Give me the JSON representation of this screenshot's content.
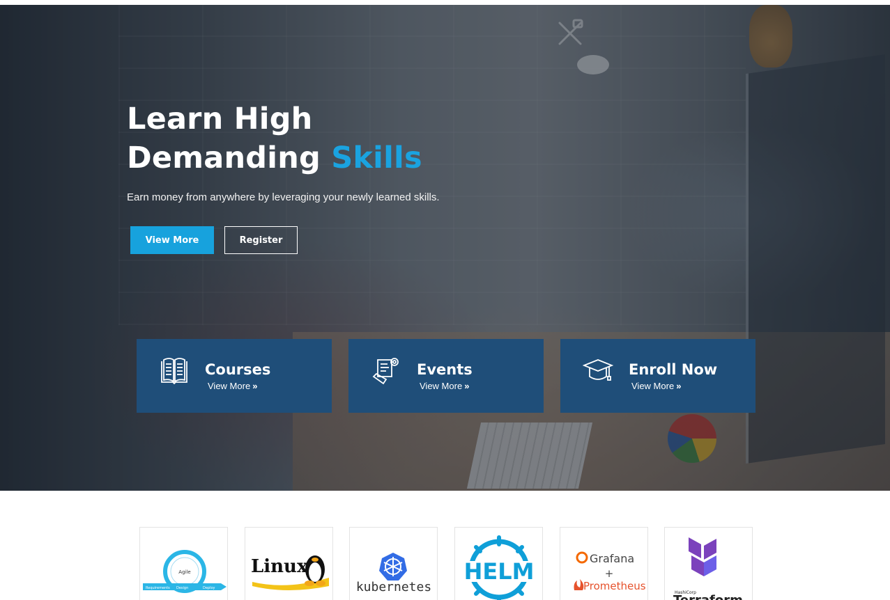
{
  "hero": {
    "title_line1": "Learn High",
    "title_line2_a": "Demanding ",
    "title_line2_accent": "Skills",
    "subtitle": "Earn money from anywhere by leveraging your newly learned skills.",
    "primary_button": "View More",
    "secondary_button": "Register",
    "accent_color": "#1aa3e0"
  },
  "cards": [
    {
      "title": "Courses",
      "link": "View More",
      "icon": "open-book-icon"
    },
    {
      "title": "Events",
      "link": "View More",
      "icon": "certificate-icon"
    },
    {
      "title": "Enroll Now",
      "link": "View More",
      "icon": "graduation-cap-icon"
    }
  ],
  "card_color": "#1f4e79",
  "logos": [
    {
      "name": "agile",
      "text": "Agile",
      "steps": [
        "Requirements",
        "Design",
        "Deploy",
        "Test",
        "Develop"
      ]
    },
    {
      "name": "linux",
      "text": "Linux"
    },
    {
      "name": "kubernetes",
      "text": "kubernetes"
    },
    {
      "name": "helm",
      "text": "HELM"
    },
    {
      "name": "grafana-prometheus",
      "text_top": "Grafana",
      "plus": "+",
      "text_bottom": "Prometheus"
    },
    {
      "name": "terraform",
      "small": "HashiCorp",
      "text": "Terraform"
    }
  ]
}
